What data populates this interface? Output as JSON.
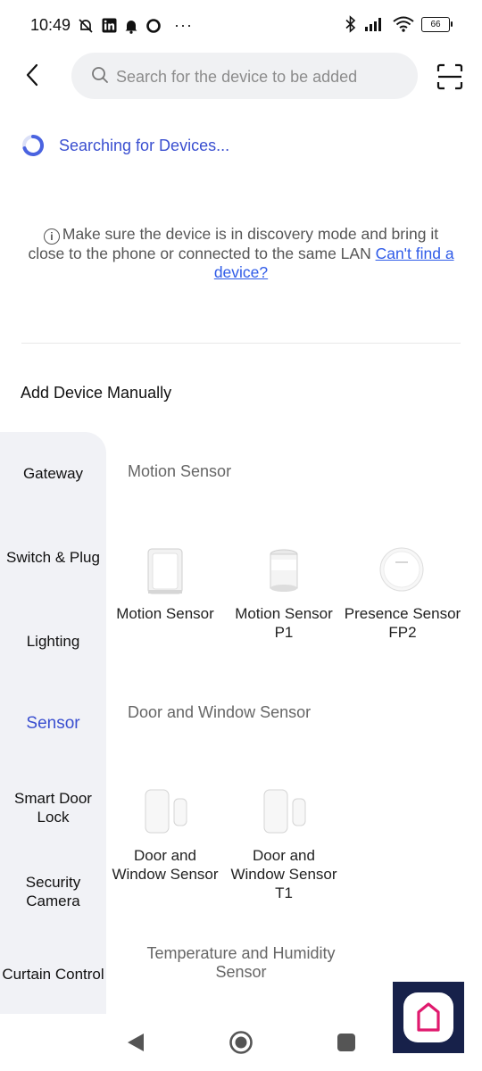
{
  "status_bar": {
    "time": "10:49",
    "more": "···",
    "battery": "66",
    "left_icons": [
      "muted-bell-icon",
      "linkedin-icon",
      "bell-icon",
      "circle-icon"
    ],
    "right_icons": [
      "bluetooth-icon",
      "signal-icon",
      "wifi-icon",
      "battery-icon"
    ]
  },
  "header": {
    "search_placeholder": "Search for the device to be added"
  },
  "searching_text": "Searching for Devices...",
  "hint": {
    "info_glyph": "i",
    "text": "Make sure the device is in discovery mode and bring it close to the phone or connected to the same LAN ",
    "link": "Can't find a device?"
  },
  "manual_title": "Add Device Manually",
  "sidebar": {
    "items": [
      {
        "label": "Gateway"
      },
      {
        "label": "Switch & Plug"
      },
      {
        "label": "Lighting"
      },
      {
        "label": "Sensor",
        "active": true
      },
      {
        "label": "Smart Door Lock"
      },
      {
        "label": "Security Camera"
      },
      {
        "label": "Curtain Control"
      }
    ]
  },
  "sections": [
    {
      "title": "Motion Sensor",
      "devices": [
        {
          "name": "Motion Sensor"
        },
        {
          "name": "Motion Sensor P1"
        },
        {
          "name": "Presence Sensor FP2"
        }
      ]
    },
    {
      "title": "Door and Window Sensor",
      "devices": [
        {
          "name": "Door and Window Sensor"
        },
        {
          "name": "Door and Window Sensor T1"
        }
      ]
    },
    {
      "title": "Temperature and Humidity Sensor",
      "devices": []
    }
  ],
  "colors": {
    "accent": "#3a4fd0",
    "link": "#2f5be8",
    "sidebar_bg": "#f1f2f6",
    "search_bg": "#f0f1f3",
    "app_tile_bg": "#17214a"
  }
}
